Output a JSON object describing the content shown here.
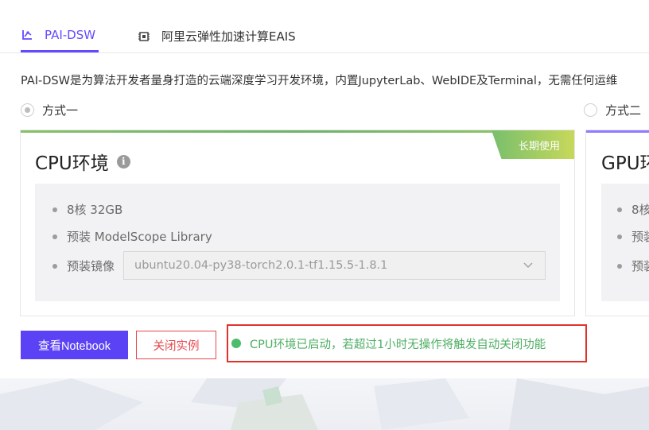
{
  "tabs": [
    {
      "label": "PAI-DSW",
      "icon": "pai-dsw-icon",
      "active": true
    },
    {
      "label": "阿里云弹性加速计算EAIS",
      "icon": "chip-icon",
      "active": false
    }
  ],
  "description": "PAI-DSW是为算法开发者量身打造的云端深度学习开发环境，内置JupyterLab、WebIDE及Terminal，无需任何运维",
  "options": {
    "option1": {
      "label": "方式一",
      "selected": true
    },
    "option2": {
      "label": "方式二",
      "selected": false
    }
  },
  "cpu_card": {
    "title": "CPU环境",
    "badge": "长期使用",
    "specs": [
      "8核 32GB",
      "预装 ModelScope Library"
    ],
    "image_label": "预装镜像",
    "image_value": "ubuntu20.04-py38-torch2.0.1-tf1.15.5-1.8.1"
  },
  "gpu_card": {
    "title": "GPU环",
    "specs": [
      "8核",
      "预装",
      "预装"
    ]
  },
  "actions": {
    "view_notebook": "查看Notebook",
    "close_instance": "关闭实例"
  },
  "status": {
    "text": "CPU环境已启动，若超过1小时无操作将触发自动关闭功能",
    "color": "#4dbd6c"
  },
  "colors": {
    "accent": "#5b43f5",
    "danger": "#e5484d",
    "highlight_border": "#e0322b"
  }
}
